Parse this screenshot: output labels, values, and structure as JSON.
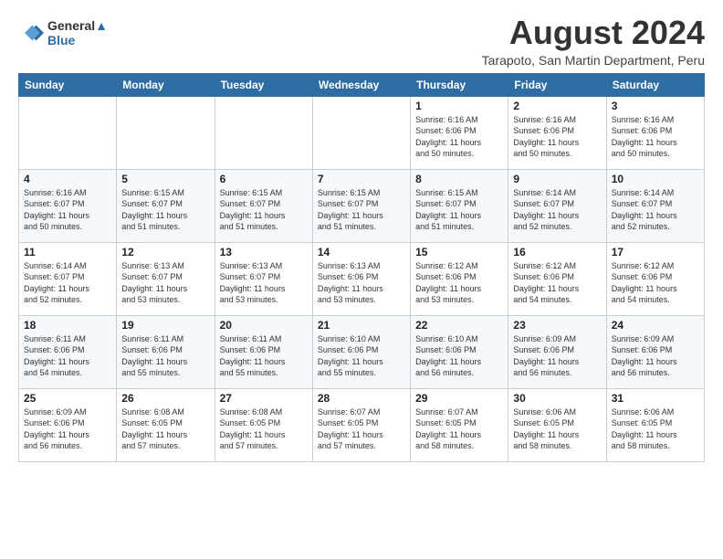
{
  "logo": {
    "line1": "General",
    "line2": "Blue"
  },
  "title": "August 2024",
  "subtitle": "Tarapoto, San Martin Department, Peru",
  "weekdays": [
    "Sunday",
    "Monday",
    "Tuesday",
    "Wednesday",
    "Thursday",
    "Friday",
    "Saturday"
  ],
  "weeks": [
    [
      {
        "day": "",
        "info": ""
      },
      {
        "day": "",
        "info": ""
      },
      {
        "day": "",
        "info": ""
      },
      {
        "day": "",
        "info": ""
      },
      {
        "day": "1",
        "info": "Sunrise: 6:16 AM\nSunset: 6:06 PM\nDaylight: 11 hours\nand 50 minutes."
      },
      {
        "day": "2",
        "info": "Sunrise: 6:16 AM\nSunset: 6:06 PM\nDaylight: 11 hours\nand 50 minutes."
      },
      {
        "day": "3",
        "info": "Sunrise: 6:16 AM\nSunset: 6:06 PM\nDaylight: 11 hours\nand 50 minutes."
      }
    ],
    [
      {
        "day": "4",
        "info": "Sunrise: 6:16 AM\nSunset: 6:07 PM\nDaylight: 11 hours\nand 50 minutes."
      },
      {
        "day": "5",
        "info": "Sunrise: 6:15 AM\nSunset: 6:07 PM\nDaylight: 11 hours\nand 51 minutes."
      },
      {
        "day": "6",
        "info": "Sunrise: 6:15 AM\nSunset: 6:07 PM\nDaylight: 11 hours\nand 51 minutes."
      },
      {
        "day": "7",
        "info": "Sunrise: 6:15 AM\nSunset: 6:07 PM\nDaylight: 11 hours\nand 51 minutes."
      },
      {
        "day": "8",
        "info": "Sunrise: 6:15 AM\nSunset: 6:07 PM\nDaylight: 11 hours\nand 51 minutes."
      },
      {
        "day": "9",
        "info": "Sunrise: 6:14 AM\nSunset: 6:07 PM\nDaylight: 11 hours\nand 52 minutes."
      },
      {
        "day": "10",
        "info": "Sunrise: 6:14 AM\nSunset: 6:07 PM\nDaylight: 11 hours\nand 52 minutes."
      }
    ],
    [
      {
        "day": "11",
        "info": "Sunrise: 6:14 AM\nSunset: 6:07 PM\nDaylight: 11 hours\nand 52 minutes."
      },
      {
        "day": "12",
        "info": "Sunrise: 6:13 AM\nSunset: 6:07 PM\nDaylight: 11 hours\nand 53 minutes."
      },
      {
        "day": "13",
        "info": "Sunrise: 6:13 AM\nSunset: 6:07 PM\nDaylight: 11 hours\nand 53 minutes."
      },
      {
        "day": "14",
        "info": "Sunrise: 6:13 AM\nSunset: 6:06 PM\nDaylight: 11 hours\nand 53 minutes."
      },
      {
        "day": "15",
        "info": "Sunrise: 6:12 AM\nSunset: 6:06 PM\nDaylight: 11 hours\nand 53 minutes."
      },
      {
        "day": "16",
        "info": "Sunrise: 6:12 AM\nSunset: 6:06 PM\nDaylight: 11 hours\nand 54 minutes."
      },
      {
        "day": "17",
        "info": "Sunrise: 6:12 AM\nSunset: 6:06 PM\nDaylight: 11 hours\nand 54 minutes."
      }
    ],
    [
      {
        "day": "18",
        "info": "Sunrise: 6:11 AM\nSunset: 6:06 PM\nDaylight: 11 hours\nand 54 minutes."
      },
      {
        "day": "19",
        "info": "Sunrise: 6:11 AM\nSunset: 6:06 PM\nDaylight: 11 hours\nand 55 minutes."
      },
      {
        "day": "20",
        "info": "Sunrise: 6:11 AM\nSunset: 6:06 PM\nDaylight: 11 hours\nand 55 minutes."
      },
      {
        "day": "21",
        "info": "Sunrise: 6:10 AM\nSunset: 6:06 PM\nDaylight: 11 hours\nand 55 minutes."
      },
      {
        "day": "22",
        "info": "Sunrise: 6:10 AM\nSunset: 6:06 PM\nDaylight: 11 hours\nand 56 minutes."
      },
      {
        "day": "23",
        "info": "Sunrise: 6:09 AM\nSunset: 6:06 PM\nDaylight: 11 hours\nand 56 minutes."
      },
      {
        "day": "24",
        "info": "Sunrise: 6:09 AM\nSunset: 6:06 PM\nDaylight: 11 hours\nand 56 minutes."
      }
    ],
    [
      {
        "day": "25",
        "info": "Sunrise: 6:09 AM\nSunset: 6:06 PM\nDaylight: 11 hours\nand 56 minutes."
      },
      {
        "day": "26",
        "info": "Sunrise: 6:08 AM\nSunset: 6:05 PM\nDaylight: 11 hours\nand 57 minutes."
      },
      {
        "day": "27",
        "info": "Sunrise: 6:08 AM\nSunset: 6:05 PM\nDaylight: 11 hours\nand 57 minutes."
      },
      {
        "day": "28",
        "info": "Sunrise: 6:07 AM\nSunset: 6:05 PM\nDaylight: 11 hours\nand 57 minutes."
      },
      {
        "day": "29",
        "info": "Sunrise: 6:07 AM\nSunset: 6:05 PM\nDaylight: 11 hours\nand 58 minutes."
      },
      {
        "day": "30",
        "info": "Sunrise: 6:06 AM\nSunset: 6:05 PM\nDaylight: 11 hours\nand 58 minutes."
      },
      {
        "day": "31",
        "info": "Sunrise: 6:06 AM\nSunset: 6:05 PM\nDaylight: 11 hours\nand 58 minutes."
      }
    ]
  ]
}
